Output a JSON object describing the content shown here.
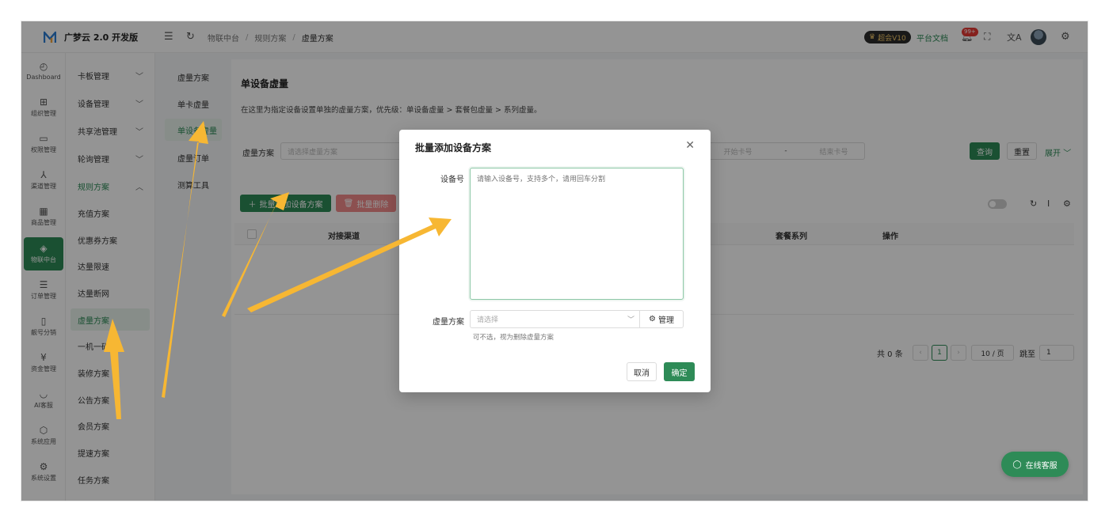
{
  "header": {
    "brand_title": "广梦云 2.0 开发版",
    "breadcrumb": [
      "物联中台",
      "规则方案",
      "虚量方案"
    ],
    "vip_label": "超会V10",
    "docs_link": "平台文档",
    "notif_count": "99+"
  },
  "rail": {
    "items": [
      {
        "label": "Dashboard",
        "icon": "◴"
      },
      {
        "label": "组织管理",
        "icon": "⊞"
      },
      {
        "label": "权限管理",
        "icon": "▭"
      },
      {
        "label": "渠道管理",
        "icon": "⅄"
      },
      {
        "label": "商品管理",
        "icon": "▦"
      },
      {
        "label": "物联中台",
        "icon": "◈"
      },
      {
        "label": "订单管理",
        "icon": "☰"
      },
      {
        "label": "靓号分销",
        "icon": "▯"
      },
      {
        "label": "资金管理",
        "icon": "¥"
      },
      {
        "label": "AI客服",
        "icon": "◡"
      },
      {
        "label": "系统应用",
        "icon": "⬡"
      },
      {
        "label": "系统设置",
        "icon": "⚙"
      }
    ]
  },
  "submenu": {
    "items": [
      {
        "label": "卡板管理",
        "chev": "﹀"
      },
      {
        "label": "设备管理",
        "chev": "﹀"
      },
      {
        "label": "共享池管理",
        "chev": "﹀"
      },
      {
        "label": "轮询管理",
        "chev": "﹀"
      },
      {
        "label": "规则方案",
        "chev": "︿"
      },
      {
        "label": "充值方案"
      },
      {
        "label": "优惠券方案"
      },
      {
        "label": "达量限速"
      },
      {
        "label": "达量断网"
      },
      {
        "label": "虚量方案"
      },
      {
        "label": "一机一码"
      },
      {
        "label": "装修方案"
      },
      {
        "label": "公告方案"
      },
      {
        "label": "会员方案"
      },
      {
        "label": "提速方案"
      },
      {
        "label": "任务方案"
      }
    ]
  },
  "tnav": {
    "items": [
      "虚量方案",
      "单卡虚量",
      "单设备虚量",
      "虚量订单",
      "测算工具"
    ]
  },
  "main": {
    "title": "单设备虚量",
    "description": "在这里为指定设备设置单独的虚量方案，优先级：单设备虚量 > 套餐包虚量 > 系列虚量。",
    "filter_label": "虚量方案",
    "filter_placeholder": "请选择虚量方案",
    "start_card": "开始卡号",
    "range_sep": "-",
    "end_card": "结束卡号",
    "query_btn": "查询",
    "reset_btn": "重置",
    "expand_link": "展开",
    "add_btn": "批量添加设备方案",
    "delete_btn": "批量删除",
    "columns": {
      "channel": "对接渠道",
      "series": "套餐系列",
      "action": "操作"
    },
    "pager": {
      "total": "共 0 条",
      "page": "1",
      "page_size": "10 / 页",
      "jump_label": "跳至",
      "jump_value": "1"
    }
  },
  "modal": {
    "title": "批量添加设备方案",
    "device_label": "设备号",
    "device_placeholder": "请输入设备号，支持多个，请用回车分割",
    "plan_label": "虚量方案",
    "plan_placeholder": "请选择",
    "manage_btn": "管理",
    "hint": "可不选，视为删除虚量方案",
    "cancel_btn": "取消",
    "confirm_btn": "确定"
  },
  "chat": {
    "label": "在线客服"
  },
  "colors": {
    "accent": "#2e8b57",
    "arrow": "#f7b733",
    "danger": "#f28b8b"
  }
}
